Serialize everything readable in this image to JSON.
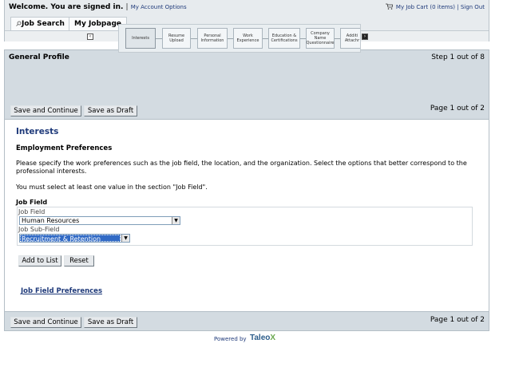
{
  "header": {
    "welcome": "Welcome. You are signed in.",
    "separator": "|",
    "account_options": "My Account Options",
    "cart": "My Job Cart (0 items)",
    "sign_out": "Sign Out",
    "cart_icon": "cart-icon"
  },
  "tabs": [
    {
      "label": "Job Search",
      "icon": "search-icon"
    },
    {
      "label": "My Jobpage"
    }
  ],
  "profile": {
    "title": "General Profile",
    "step": "Step 1 out of 8",
    "page": "Page 1 out of 2",
    "steps": [
      {
        "label": "Interests",
        "current": true
      },
      {
        "label": "Resume Upload"
      },
      {
        "label": "Personal Information"
      },
      {
        "label": "Work Experience"
      },
      {
        "label": "Education & Certifications"
      },
      {
        "label": "Company Name Questionnaire"
      },
      {
        "label": "Additi Attachr"
      }
    ]
  },
  "buttons": {
    "save_continue": "Save and Continue",
    "save_draft": "Save as Draft",
    "add_to_list": "Add to List",
    "reset": "Reset"
  },
  "content": {
    "section_title": "Interests",
    "subsection_title": "Employment Preferences",
    "instructions": "Please specify the work preferences such as the job field, the location, and the organization. Select the options that better correspond to the professional interests.",
    "must_select": "You must select at least one value in the section \"Job Field\".",
    "job_field_heading": "Job Field",
    "job_field_label": "Job Field",
    "job_field_value": "Human Resources",
    "job_subfield_label": "Job Sub-Field",
    "job_subfield_value": "Recruitment & Retention",
    "preferences_link": "Job Field Preferences"
  },
  "footer": {
    "page": "Page 1 out of 2",
    "powered_by": "Powered by",
    "brand": "Taleo",
    "brand_mark": "X"
  }
}
